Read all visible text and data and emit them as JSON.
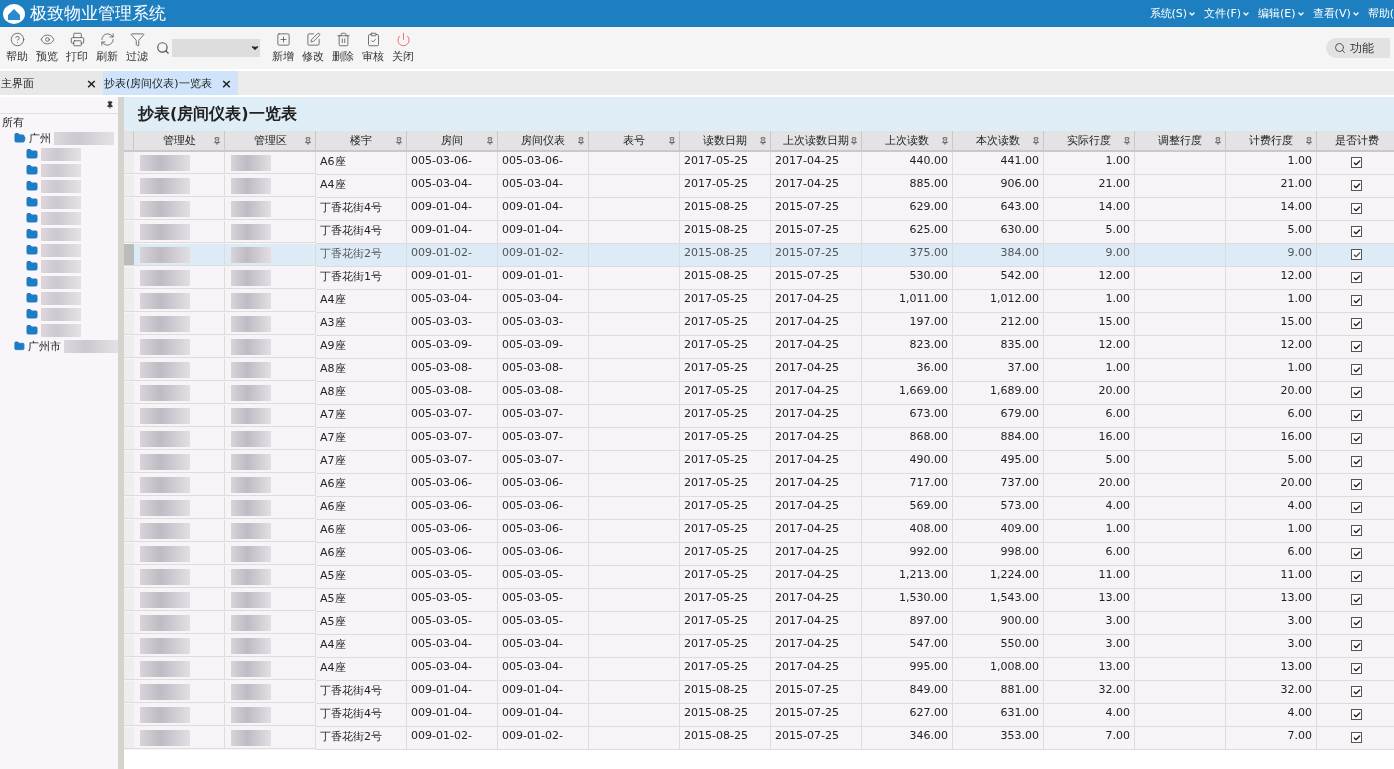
{
  "window": {
    "title": "极致物业管理系统"
  },
  "menu": [
    {
      "label": "系统(S)",
      "has_caret": true
    },
    {
      "label": "文件(F)",
      "has_caret": true
    },
    {
      "label": "编辑(E)",
      "has_caret": true
    },
    {
      "label": "查看(V)",
      "has_caret": true
    },
    {
      "label": "帮助(",
      "has_caret": false
    }
  ],
  "toolbar": {
    "left": [
      {
        "kind": "help",
        "label": "帮助"
      },
      {
        "kind": "preview",
        "label": "预览"
      },
      {
        "kind": "print",
        "label": "打印"
      },
      {
        "kind": "refresh",
        "label": "刷新"
      },
      {
        "kind": "filter",
        "label": "过滤"
      }
    ],
    "right": [
      {
        "kind": "add",
        "label": "新增"
      },
      {
        "kind": "edit",
        "label": "修改"
      },
      {
        "kind": "delete",
        "label": "删除"
      },
      {
        "kind": "audit",
        "label": "审核"
      },
      {
        "kind": "close",
        "label": "关闭"
      }
    ],
    "function_search": {
      "placeholder": "功能"
    }
  },
  "tabs": [
    {
      "label": "主界面",
      "close": "×",
      "selected": false
    },
    {
      "label": "抄表(房间仪表)一览表",
      "close": "×",
      "selected": true
    }
  ],
  "sidebar": {
    "tree": [
      {
        "label": "所有",
        "children": [
          {
            "label": "广州",
            "expanded": true,
            "children": [
              {
                "kind": "folder"
              },
              {
                "kind": "folder"
              },
              {
                "kind": "folder"
              },
              {
                "kind": "folder"
              },
              {
                "kind": "folder"
              },
              {
                "kind": "folder"
              },
              {
                "kind": "folder"
              },
              {
                "kind": "folder"
              },
              {
                "kind": "folder"
              },
              {
                "kind": "folder"
              },
              {
                "kind": "folder"
              },
              {
                "kind": "folder"
              }
            ]
          },
          {
            "label": "广州市",
            "expanded": false
          }
        ]
      }
    ]
  },
  "page_title": "抄表(房间仪表)一览表",
  "table": {
    "columns": [
      "管理处",
      "管理区",
      "楼宇",
      "房间",
      "房间仪表",
      "表号",
      "读数日期",
      "上次读数日期",
      "上次读数",
      "本次读数",
      "实际行度",
      "调整行度",
      "计费行度",
      "是否计费"
    ],
    "rows": [
      {
        "building": "A6座",
        "room": "005-03-06-",
        "meter": "005-03-06-",
        "date": "2017-05-25",
        "last_date": "2017-04-25",
        "last": "440.00",
        "current": "441.00",
        "actual": "1.00",
        "billed": "1.00",
        "charged": true,
        "selected": false
      },
      {
        "building": "A4座",
        "room": "005-03-04-",
        "meter": "005-03-04-",
        "date": "2017-05-25",
        "last_date": "2017-04-25",
        "last": "885.00",
        "current": "906.00",
        "actual": "21.00",
        "billed": "21.00",
        "charged": true,
        "selected": false
      },
      {
        "building": "丁香花街4号",
        "room": "009-01-04-",
        "meter": "009-01-04-",
        "date": "2015-08-25",
        "last_date": "2015-07-25",
        "last": "629.00",
        "current": "643.00",
        "actual": "14.00",
        "billed": "14.00",
        "charged": true,
        "selected": false
      },
      {
        "building": "丁香花街4号",
        "room": "009-01-04-",
        "meter": "009-01-04-",
        "date": "2015-08-25",
        "last_date": "2015-07-25",
        "last": "625.00",
        "current": "630.00",
        "actual": "5.00",
        "billed": "5.00",
        "charged": true,
        "selected": false
      },
      {
        "building": "丁香花街2号",
        "room": "009-01-02-",
        "meter": "009-01-02-",
        "date": "2015-08-25",
        "last_date": "2015-07-25",
        "last": "375.00",
        "current": "384.00",
        "actual": "9.00",
        "billed": "9.00",
        "charged": true,
        "selected": true
      },
      {
        "building": "丁香花街1号",
        "room": "009-01-01-",
        "meter": "009-01-01-",
        "date": "2015-08-25",
        "last_date": "2015-07-25",
        "last": "530.00",
        "current": "542.00",
        "actual": "12.00",
        "billed": "12.00",
        "charged": true,
        "selected": false
      },
      {
        "building": "A4座",
        "room": "005-03-04-",
        "meter": "005-03-04-",
        "date": "2017-05-25",
        "last_date": "2017-04-25",
        "last": "1,011.00",
        "current": "1,012.00",
        "actual": "1.00",
        "billed": "1.00",
        "charged": true,
        "selected": false
      },
      {
        "building": "A3座",
        "room": "005-03-03-",
        "meter": "005-03-03-",
        "date": "2017-05-25",
        "last_date": "2017-04-25",
        "last": "197.00",
        "current": "212.00",
        "actual": "15.00",
        "billed": "15.00",
        "charged": true,
        "selected": false
      },
      {
        "building": "A9座",
        "room": "005-03-09-",
        "meter": "005-03-09-",
        "date": "2017-05-25",
        "last_date": "2017-04-25",
        "last": "823.00",
        "current": "835.00",
        "actual": "12.00",
        "billed": "12.00",
        "charged": true,
        "selected": false
      },
      {
        "building": "A8座",
        "room": "005-03-08-",
        "meter": "005-03-08-",
        "date": "2017-05-25",
        "last_date": "2017-04-25",
        "last": "36.00",
        "current": "37.00",
        "actual": "1.00",
        "billed": "1.00",
        "charged": true,
        "selected": false
      },
      {
        "building": "A8座",
        "room": "005-03-08-",
        "meter": "005-03-08-",
        "date": "2017-05-25",
        "last_date": "2017-04-25",
        "last": "1,669.00",
        "current": "1,689.00",
        "actual": "20.00",
        "billed": "20.00",
        "charged": true,
        "selected": false
      },
      {
        "building": "A7座",
        "room": "005-03-07-",
        "meter": "005-03-07-",
        "date": "2017-05-25",
        "last_date": "2017-04-25",
        "last": "673.00",
        "current": "679.00",
        "actual": "6.00",
        "billed": "6.00",
        "charged": true,
        "selected": false
      },
      {
        "building": "A7座",
        "room": "005-03-07-",
        "meter": "005-03-07-",
        "date": "2017-05-25",
        "last_date": "2017-04-25",
        "last": "868.00",
        "current": "884.00",
        "actual": "16.00",
        "billed": "16.00",
        "charged": true,
        "selected": false
      },
      {
        "building": "A7座",
        "room": "005-03-07-",
        "meter": "005-03-07-",
        "date": "2017-05-25",
        "last_date": "2017-04-25",
        "last": "490.00",
        "current": "495.00",
        "actual": "5.00",
        "billed": "5.00",
        "charged": true,
        "selected": false
      },
      {
        "building": "A6座",
        "room": "005-03-06-",
        "meter": "005-03-06-",
        "date": "2017-05-25",
        "last_date": "2017-04-25",
        "last": "717.00",
        "current": "737.00",
        "actual": "20.00",
        "billed": "20.00",
        "charged": true,
        "selected": false
      },
      {
        "building": "A6座",
        "room": "005-03-06-",
        "meter": "005-03-06-",
        "date": "2017-05-25",
        "last_date": "2017-04-25",
        "last": "569.00",
        "current": "573.00",
        "actual": "4.00",
        "billed": "4.00",
        "charged": true,
        "selected": false
      },
      {
        "building": "A6座",
        "room": "005-03-06-",
        "meter": "005-03-06-",
        "date": "2017-05-25",
        "last_date": "2017-04-25",
        "last": "408.00",
        "current": "409.00",
        "actual": "1.00",
        "billed": "1.00",
        "charged": true,
        "selected": false
      },
      {
        "building": "A6座",
        "room": "005-03-06-",
        "meter": "005-03-06-",
        "date": "2017-05-25",
        "last_date": "2017-04-25",
        "last": "992.00",
        "current": "998.00",
        "actual": "6.00",
        "billed": "6.00",
        "charged": true,
        "selected": false
      },
      {
        "building": "A5座",
        "room": "005-03-05-",
        "meter": "005-03-05-",
        "date": "2017-05-25",
        "last_date": "2017-04-25",
        "last": "1,213.00",
        "current": "1,224.00",
        "actual": "11.00",
        "billed": "11.00",
        "charged": true,
        "selected": false
      },
      {
        "building": "A5座",
        "room": "005-03-05-",
        "meter": "005-03-05-",
        "date": "2017-05-25",
        "last_date": "2017-04-25",
        "last": "1,530.00",
        "current": "1,543.00",
        "actual": "13.00",
        "billed": "13.00",
        "charged": true,
        "selected": false
      },
      {
        "building": "A5座",
        "room": "005-03-05-",
        "meter": "005-03-05-",
        "date": "2017-05-25",
        "last_date": "2017-04-25",
        "last": "897.00",
        "current": "900.00",
        "actual": "3.00",
        "billed": "3.00",
        "charged": true,
        "selected": false
      },
      {
        "building": "A4座",
        "room": "005-03-04-",
        "meter": "005-03-04-",
        "date": "2017-05-25",
        "last_date": "2017-04-25",
        "last": "547.00",
        "current": "550.00",
        "actual": "3.00",
        "billed": "3.00",
        "charged": true,
        "selected": false
      },
      {
        "building": "A4座",
        "room": "005-03-04-",
        "meter": "005-03-04-",
        "date": "2017-05-25",
        "last_date": "2017-04-25",
        "last": "995.00",
        "current": "1,008.00",
        "actual": "13.00",
        "billed": "13.00",
        "charged": true,
        "selected": false
      },
      {
        "building": "丁香花街4号",
        "room": "009-01-04-",
        "meter": "009-01-04-",
        "date": "2015-08-25",
        "last_date": "2015-07-25",
        "last": "849.00",
        "current": "881.00",
        "actual": "32.00",
        "billed": "32.00",
        "charged": true,
        "selected": false
      },
      {
        "building": "丁香花街4号",
        "room": "009-01-04-",
        "meter": "009-01-04-",
        "date": "2015-08-25",
        "last_date": "2015-07-25",
        "last": "627.00",
        "current": "631.00",
        "actual": "4.00",
        "billed": "4.00",
        "charged": true,
        "selected": false
      },
      {
        "building": "丁香花街2号",
        "room": "009-01-02-",
        "meter": "009-01-02-",
        "date": "2015-08-25",
        "last_date": "2015-07-25",
        "last": "346.00",
        "current": "353.00",
        "actual": "7.00",
        "billed": "7.00",
        "charged": true,
        "selected": false
      }
    ]
  }
}
